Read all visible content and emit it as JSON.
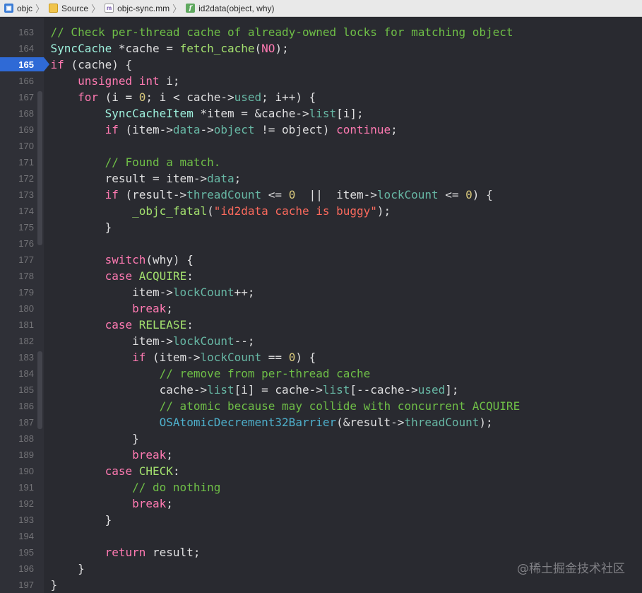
{
  "breadcrumb": {
    "items": [
      {
        "label": "objc",
        "icon": "project-icon"
      },
      {
        "label": "Source",
        "icon": "folder-icon"
      },
      {
        "label": "objc-sync.mm",
        "icon": "m-file-icon"
      },
      {
        "label": "id2data(object, why)",
        "icon": "function-icon"
      }
    ],
    "separator": "〉",
    "file_icon_glyph": "m",
    "func_icon_glyph": "f"
  },
  "editor": {
    "current_line": "165",
    "colors": {
      "background": "#292a30",
      "keyword": "#ff7ab2",
      "comment": "#6fbf47",
      "string": "#fc6a5d",
      "number": "#d9c97c",
      "identifier": "#67b7a4",
      "current_line_marker": "#2f6ad6"
    },
    "lines": [
      {
        "n": "163",
        "tokens": [
          [
            "    // Check per-thread cache of already-owned locks for matching object",
            "cm"
          ]
        ]
      },
      {
        "n": "164",
        "tokens": [
          [
            "    ",
            "pl"
          ],
          [
            "SyncCache",
            "ty"
          ],
          [
            " *cache = ",
            "pl"
          ],
          [
            "fetch_cache",
            "cs"
          ],
          [
            "(",
            "pl"
          ],
          [
            "NO",
            "kw"
          ],
          [
            ");",
            "pl"
          ]
        ]
      },
      {
        "n": "165",
        "tokens": [
          [
            "    ",
            "pl"
          ],
          [
            "if",
            "kw"
          ],
          [
            " (cache) {",
            "pl"
          ]
        ]
      },
      {
        "n": "166",
        "tokens": [
          [
            "        ",
            "pl"
          ],
          [
            "unsigned int",
            "kw"
          ],
          [
            " i;",
            "pl"
          ]
        ]
      },
      {
        "n": "167",
        "tokens": [
          [
            "        ",
            "pl"
          ],
          [
            "for",
            "kw"
          ],
          [
            " (i = ",
            "pl"
          ],
          [
            "0",
            "nu"
          ],
          [
            "; i < cache->",
            "pl"
          ],
          [
            "used",
            "id"
          ],
          [
            "; i++) {",
            "pl"
          ]
        ]
      },
      {
        "n": "168",
        "tokens": [
          [
            "            ",
            "pl"
          ],
          [
            "SyncCacheItem",
            "ty"
          ],
          [
            " *item = &cache->",
            "pl"
          ],
          [
            "list",
            "id"
          ],
          [
            "[i];",
            "pl"
          ]
        ]
      },
      {
        "n": "169",
        "tokens": [
          [
            "            ",
            "pl"
          ],
          [
            "if",
            "kw"
          ],
          [
            " (item->",
            "pl"
          ],
          [
            "data",
            "id"
          ],
          [
            "->",
            "pl"
          ],
          [
            "object",
            "id"
          ],
          [
            " != object) ",
            "pl"
          ],
          [
            "continue",
            "kw"
          ],
          [
            ";",
            "pl"
          ]
        ]
      },
      {
        "n": "170",
        "tokens": [
          [
            "",
            "pl"
          ]
        ]
      },
      {
        "n": "171",
        "tokens": [
          [
            "            // Found a match.",
            "cm"
          ]
        ]
      },
      {
        "n": "172",
        "tokens": [
          [
            "            result = item->",
            "pl"
          ],
          [
            "data",
            "id"
          ],
          [
            ";",
            "pl"
          ]
        ]
      },
      {
        "n": "173",
        "tokens": [
          [
            "            ",
            "pl"
          ],
          [
            "if",
            "kw"
          ],
          [
            " (result->",
            "pl"
          ],
          [
            "threadCount",
            "id"
          ],
          [
            " <= ",
            "pl"
          ],
          [
            "0",
            "nu"
          ],
          [
            "  ||  item->",
            "pl"
          ],
          [
            "lockCount",
            "id"
          ],
          [
            " <= ",
            "pl"
          ],
          [
            "0",
            "nu"
          ],
          [
            ") {",
            "pl"
          ]
        ]
      },
      {
        "n": "174",
        "tokens": [
          [
            "                ",
            "pl"
          ],
          [
            "_objc_fatal",
            "cs"
          ],
          [
            "(",
            "pl"
          ],
          [
            "\"id2data cache is buggy\"",
            "st"
          ],
          [
            ");",
            "pl"
          ]
        ]
      },
      {
        "n": "175",
        "tokens": [
          [
            "            }",
            "pl"
          ]
        ]
      },
      {
        "n": "176",
        "tokens": [
          [
            "",
            "pl"
          ]
        ]
      },
      {
        "n": "177",
        "tokens": [
          [
            "            ",
            "pl"
          ],
          [
            "switch",
            "kw"
          ],
          [
            "(why) {",
            "pl"
          ]
        ]
      },
      {
        "n": "178",
        "tokens": [
          [
            "            ",
            "pl"
          ],
          [
            "case",
            "kw"
          ],
          [
            " ",
            "pl"
          ],
          [
            "ACQUIRE",
            "cs"
          ],
          [
            ":",
            "pl"
          ]
        ]
      },
      {
        "n": "179",
        "tokens": [
          [
            "                item->",
            "pl"
          ],
          [
            "lockCount",
            "id"
          ],
          [
            "++;",
            "pl"
          ]
        ]
      },
      {
        "n": "180",
        "tokens": [
          [
            "                ",
            "pl"
          ],
          [
            "break",
            "kw"
          ],
          [
            ";",
            "pl"
          ]
        ]
      },
      {
        "n": "181",
        "tokens": [
          [
            "            ",
            "pl"
          ],
          [
            "case",
            "kw"
          ],
          [
            " ",
            "pl"
          ],
          [
            "RELEASE",
            "cs"
          ],
          [
            ":",
            "pl"
          ]
        ]
      },
      {
        "n": "182",
        "tokens": [
          [
            "                item->",
            "pl"
          ],
          [
            "lockCount",
            "id"
          ],
          [
            "--;",
            "pl"
          ]
        ]
      },
      {
        "n": "183",
        "tokens": [
          [
            "                ",
            "pl"
          ],
          [
            "if",
            "kw"
          ],
          [
            " (item->",
            "pl"
          ],
          [
            "lockCount",
            "id"
          ],
          [
            " == ",
            "pl"
          ],
          [
            "0",
            "nu"
          ],
          [
            ") {",
            "pl"
          ]
        ]
      },
      {
        "n": "184",
        "tokens": [
          [
            "                    // remove from per-thread cache",
            "cm"
          ]
        ]
      },
      {
        "n": "185",
        "tokens": [
          [
            "                    cache->",
            "pl"
          ],
          [
            "list",
            "id"
          ],
          [
            "[i] = cache->",
            "pl"
          ],
          [
            "list",
            "id"
          ],
          [
            "[--cache->",
            "pl"
          ],
          [
            "used",
            "id"
          ],
          [
            "];",
            "pl"
          ]
        ]
      },
      {
        "n": "186",
        "tokens": [
          [
            "                    // atomic because may collide with concurrent ACQUIRE",
            "cm"
          ]
        ]
      },
      {
        "n": "187",
        "tokens": [
          [
            "                    ",
            "pl"
          ],
          [
            "OSAtomicDecrement32Barrier",
            "fn"
          ],
          [
            "(&result->",
            "pl"
          ],
          [
            "threadCount",
            "id"
          ],
          [
            ");",
            "pl"
          ]
        ]
      },
      {
        "n": "188",
        "tokens": [
          [
            "                }",
            "pl"
          ]
        ]
      },
      {
        "n": "189",
        "tokens": [
          [
            "                ",
            "pl"
          ],
          [
            "break",
            "kw"
          ],
          [
            ";",
            "pl"
          ]
        ]
      },
      {
        "n": "190",
        "tokens": [
          [
            "            ",
            "pl"
          ],
          [
            "case",
            "kw"
          ],
          [
            " ",
            "pl"
          ],
          [
            "CHECK",
            "cs"
          ],
          [
            ":",
            "pl"
          ]
        ]
      },
      {
        "n": "191",
        "tokens": [
          [
            "                // do nothing",
            "cm"
          ]
        ]
      },
      {
        "n": "192",
        "tokens": [
          [
            "                ",
            "pl"
          ],
          [
            "break",
            "kw"
          ],
          [
            ";",
            "pl"
          ]
        ]
      },
      {
        "n": "193",
        "tokens": [
          [
            "            }",
            "pl"
          ]
        ]
      },
      {
        "n": "194",
        "tokens": [
          [
            "",
            "pl"
          ]
        ]
      },
      {
        "n": "195",
        "tokens": [
          [
            "            ",
            "pl"
          ],
          [
            "return",
            "kw"
          ],
          [
            " result;",
            "pl"
          ]
        ]
      },
      {
        "n": "196",
        "tokens": [
          [
            "        }",
            "pl"
          ]
        ]
      },
      {
        "n": "197",
        "tokens": [
          [
            "    }",
            "pl"
          ]
        ]
      }
    ]
  },
  "watermark": "@稀土掘金技术社区"
}
